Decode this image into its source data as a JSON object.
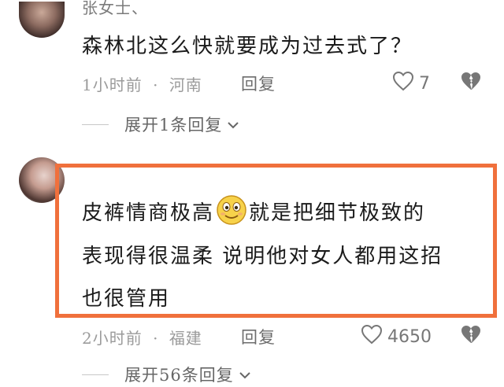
{
  "comments": [
    {
      "username": "张女士、",
      "text": "森林北这么快就要成为过去式了？",
      "time": "1小时前",
      "location": "河南",
      "reply_label": "回复",
      "likes": "7",
      "expand_label": "展开1条回复"
    },
    {
      "text_line1_a": "皮裤情商极高",
      "text_line1_b": "就是把细节极致的",
      "text_line2": "表现得很温柔 说明他对女人都用这招",
      "text_line3": "也很管用",
      "time": "2小时前",
      "location": "福建",
      "reply_label": "回复",
      "likes": "4650",
      "expand_label": "展开56条回复"
    }
  ],
  "separator": "·",
  "highlight_color": "#f0703c",
  "icons": [
    "heart-icon",
    "broken-heart-icon",
    "chevron-down-icon",
    "smile-emoji-icon"
  ]
}
